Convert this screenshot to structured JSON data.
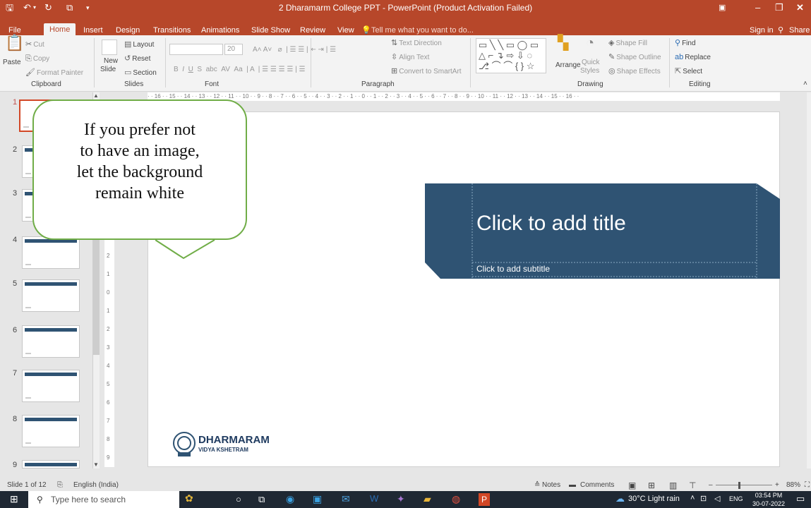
{
  "titlebar": {
    "title": "2 Dharamarm College PPT - PowerPoint (Product Activation Failed)",
    "save_icon": "save-icon",
    "undo_icon": "undo-icon",
    "redo_icon": "redo-icon",
    "present_icon": "present-from-start-icon",
    "customize_icon": "customize-toolbar-icon"
  },
  "tabs": [
    "File",
    "Home",
    "Insert",
    "Design",
    "Transitions",
    "Animations",
    "Slide Show",
    "Review",
    "View"
  ],
  "tell_me": "Tell me what you want to do...",
  "sign_in": "Sign in",
  "share": "Share",
  "ribbon": {
    "clipboard": {
      "label": "Clipboard",
      "paste": "Paste",
      "cut": "Cut",
      "copy": "Copy",
      "format_painter": "Format Painter"
    },
    "slides": {
      "label": "Slides",
      "new_slide": "New",
      "new_slide2": "Slide",
      "layout": "Layout",
      "reset": "Reset",
      "section": "Section"
    },
    "font": {
      "label": "Font",
      "size": "20"
    },
    "paragraph": {
      "label": "Paragraph",
      "text_direction": "Text Direction",
      "align_text": "Align Text",
      "convert": "Convert to SmartArt"
    },
    "drawing": {
      "label": "Drawing",
      "arrange": "Arrange",
      "quick_styles": "Quick",
      "quick_styles2": "Styles",
      "shape_fill": "Shape Fill",
      "shape_outline": "Shape Outline",
      "shape_effects": "Shape Effects"
    },
    "editing": {
      "label": "Editing",
      "find": "Find",
      "replace": "Replace",
      "select": "Select"
    }
  },
  "slides": [
    "1",
    "2",
    "3",
    "4",
    "5",
    "6",
    "7",
    "8",
    "9"
  ],
  "ruler": {
    "h": "· · 16 · · 15 · · 14 · · 13 · · 12 · · 11 · · 10 · · 9 · · 8 · · 7 · · 6 · · 5 · · 4 · · 3 · · 2 · · 1 · · 0 · · 1 · · 2 · · 3 · · 4 · · 5 · · 6 · · 7 · · 8 · · 9 · · 10 · · 11 · · 12 · · 13 · · 14 · · 15 · · 16 · ·",
    "v": [
      "2",
      "1",
      "0",
      "1",
      "2",
      "3",
      "4",
      "5",
      "6",
      "7",
      "8",
      "9"
    ]
  },
  "slide": {
    "title_placeholder": "Click to add title",
    "subtitle_placeholder": "Click to add subtitle",
    "logo_name": "DHARMARAM",
    "logo_sub": "VIDYA KSHETRAM",
    "accent": "#2f5373"
  },
  "callout": {
    "lines": [
      "If you prefer not",
      "to have an image,",
      "let the background",
      "remain white"
    ]
  },
  "status": {
    "slide_count": "Slide 1 of 12",
    "language": "English (India)",
    "notes": "Notes",
    "comments": "Comments",
    "zoom": "88%"
  },
  "taskbar": {
    "search_placeholder": "Type here to search",
    "weather": "30°C  Light rain",
    "lang": "ENG",
    "time": "03:54 PM",
    "date": "30-07-2022"
  },
  "colors": {
    "brand": "#b7472a",
    "accent": "#2f5373",
    "callout_border": "#70ad47"
  }
}
